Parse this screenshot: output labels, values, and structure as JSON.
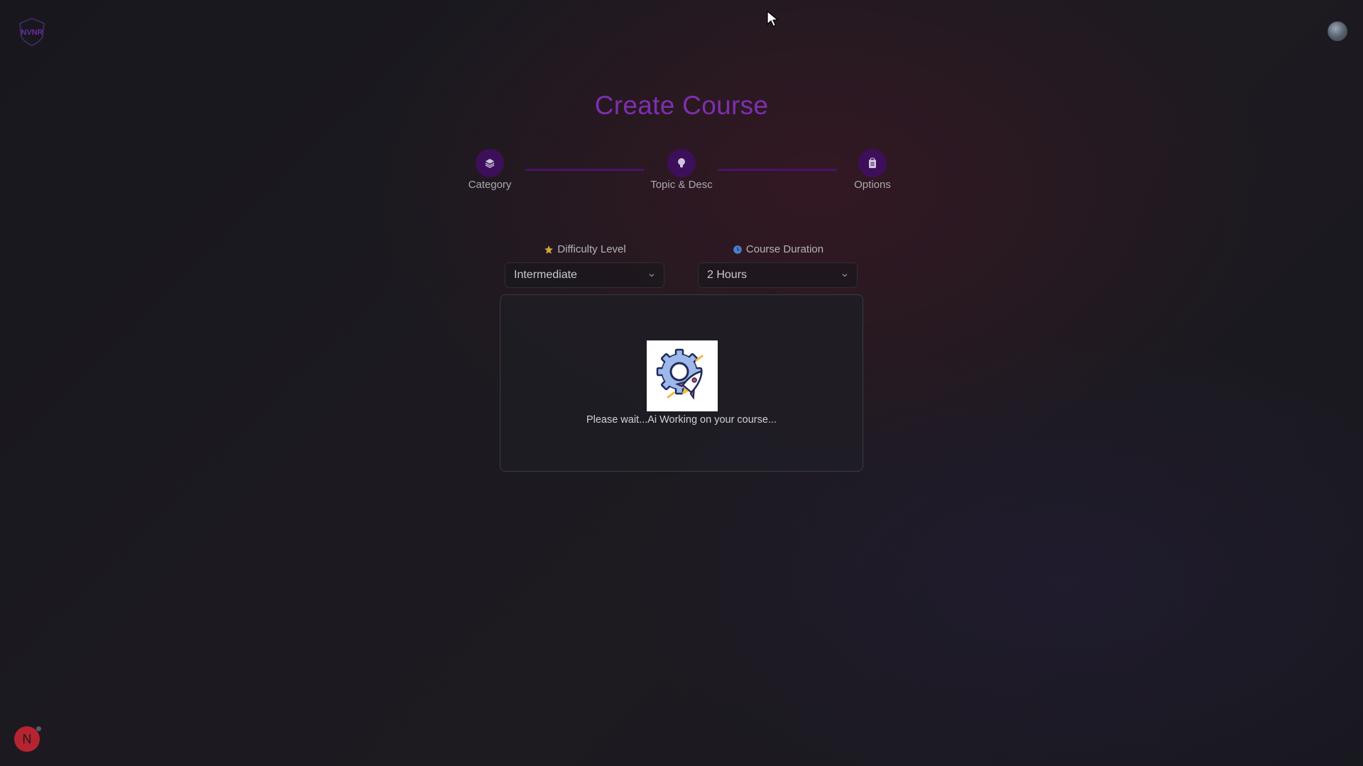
{
  "brand": {
    "logo_text": "NVNR",
    "logo_icon": "shield-logo-icon"
  },
  "header": {
    "avatar_icon": "user-avatar-icon"
  },
  "page": {
    "title": "Create Course"
  },
  "stepper": {
    "steps": [
      {
        "label": "Category",
        "icon": "layers-icon"
      },
      {
        "label": "Topic & Desc",
        "icon": "lightbulb-icon"
      },
      {
        "label": "Options",
        "icon": "clipboard-icon"
      }
    ],
    "accent_color": "#3d0f5a",
    "line_color": "#4c1268"
  },
  "options": {
    "difficulty": {
      "label": "Difficulty Level",
      "icon": "star-icon",
      "value": "Intermediate"
    },
    "duration": {
      "label": "Course Duration",
      "icon": "clock-icon",
      "value": "2 Hours"
    }
  },
  "loading": {
    "message": "Please wait...Ai Working on your course...",
    "image_icon": "gear-rocket-icon"
  },
  "dev_badge": {
    "letter": "N"
  },
  "colors": {
    "title": "#7e2fb0",
    "badge": "#b52430"
  }
}
